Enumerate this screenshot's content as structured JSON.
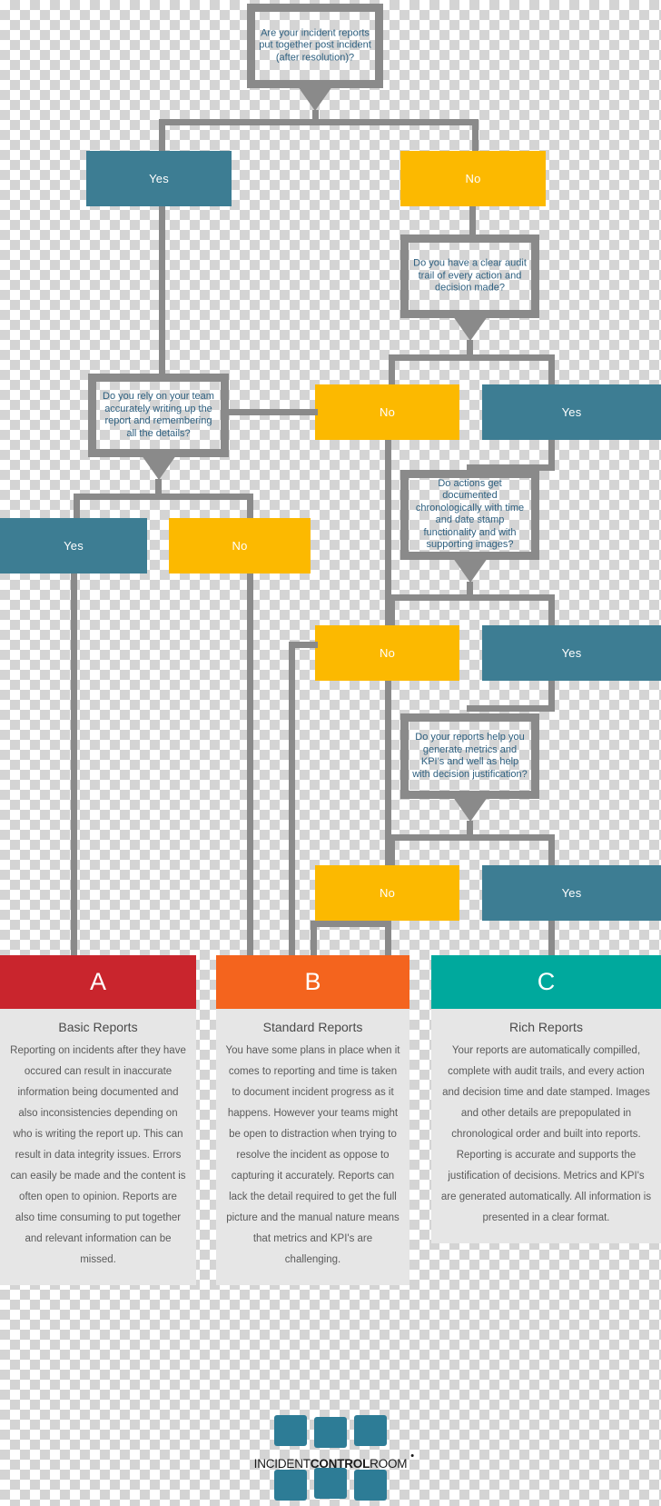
{
  "diagram": {
    "title": "Incident reporting decision flowchart",
    "colors": {
      "yes": "#3d7d93",
      "no": "#fcb900",
      "connector": "#8a8a8a",
      "question_text": "#2d5f7f",
      "card_a": "#c9252d",
      "card_b": "#f4641e",
      "card_c": "#00a99d",
      "card_body": "#e6e6e6"
    },
    "questions": [
      {
        "id": "q1",
        "text": "Are your incident reports put together post incident (after resolution)?"
      },
      {
        "id": "q2",
        "text": "Do you have a clear audit trail of every action and decision made?"
      },
      {
        "id": "q3",
        "text": "Do you rely on your team accurately writing up the report and remembering all the details?"
      },
      {
        "id": "q4",
        "text": "Do actions get documented chronologically with time and date stamp functionality and with supporting images?"
      },
      {
        "id": "q5",
        "text": "Do your reports help you generate metrics and KPI's and well as help with decision justification?"
      }
    ],
    "answers": {
      "q1_yes": "Yes",
      "q1_no": "No",
      "q2_no": "No",
      "q2_yes": "Yes",
      "q3_yes": "Yes",
      "q3_no": "No",
      "q4_no": "No",
      "q4_yes": "Yes",
      "q5_no": "No",
      "q5_yes": "Yes"
    },
    "results": [
      {
        "letter": "A",
        "title": "Basic Reports",
        "description": "Reporting on incidents after they have occured can result in inaccurate information being documented and also inconsistencies depending on who is writing the report up. This can result in data integrity issues. Errors can easily be made and the content is often open to opinion. Reports are also time consuming to put together and relevant information can be missed."
      },
      {
        "letter": "B",
        "title": "Standard Reports",
        "description": "You have some plans in place when it comes to reporting and time is taken to document incident progress as it happens. However your teams might be open to distraction when trying to resolve the incident as oppose to capturing it accurately. Reports can lack the detail required to get the full picture and the manual nature means that metrics and KPI's are challenging."
      },
      {
        "letter": "C",
        "title": "Rich Reports",
        "description": "Your reports are automatically compilled, complete with audit trails, and every action and decision time and date stamped. Images and other details are prepopulated in chronological order and built into reports. Reporting is accurate and supports the justification of decisions. Metrics and KPI's are generated automatically. All information is presented in a clear format."
      }
    ],
    "logo": {
      "word_1": "INCIDENT",
      "word_2": "CONTROL",
      "word_3": "ROOM"
    }
  }
}
